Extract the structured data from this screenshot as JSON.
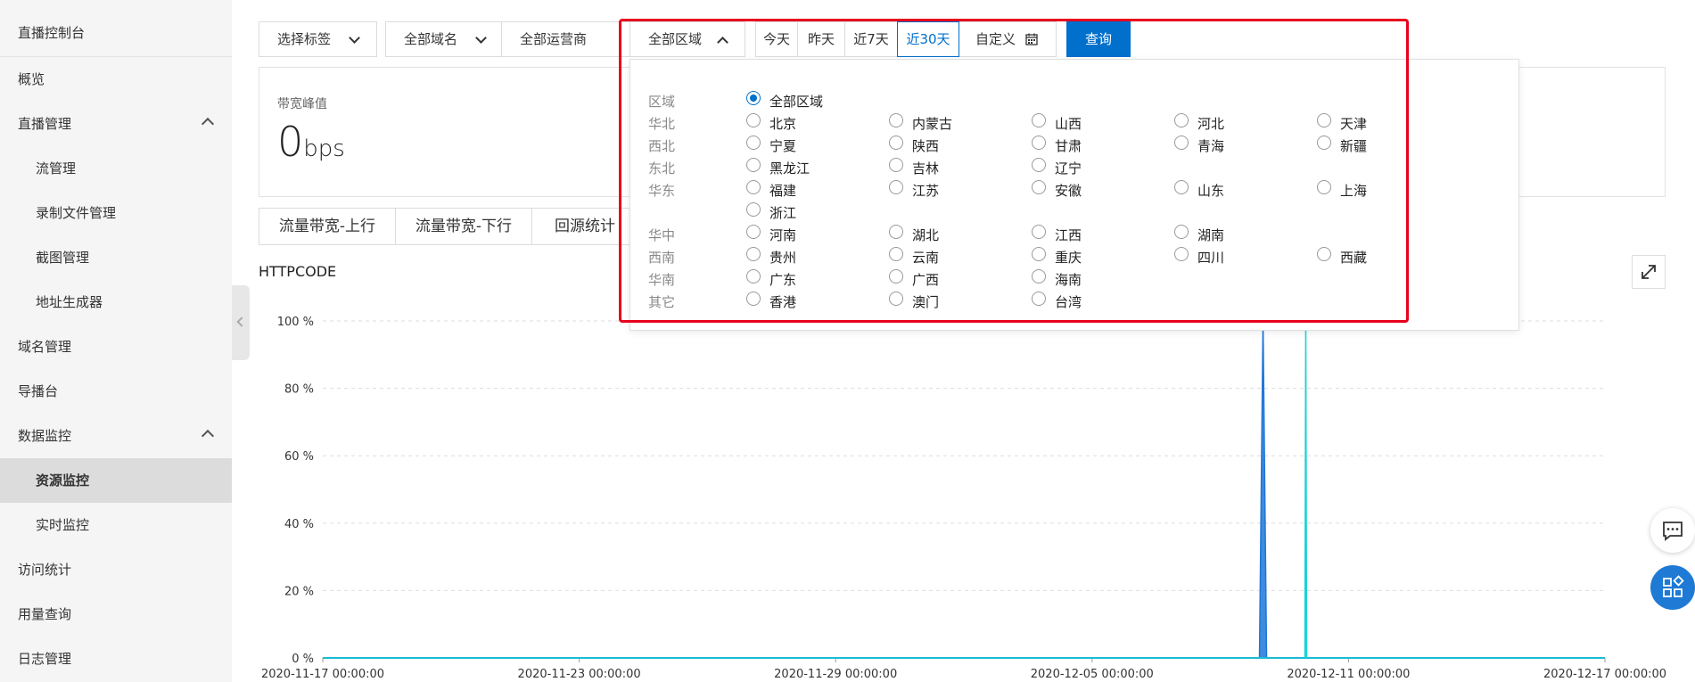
{
  "sidebar": {
    "title": "直播控制台",
    "items": [
      {
        "label": "概览",
        "sub": false
      },
      {
        "label": "直播管理",
        "sub": false,
        "expanded": true
      },
      {
        "label": "流管理",
        "sub": true
      },
      {
        "label": "录制文件管理",
        "sub": true
      },
      {
        "label": "截图管理",
        "sub": true
      },
      {
        "label": "地址生成器",
        "sub": true
      },
      {
        "label": "域名管理",
        "sub": false
      },
      {
        "label": "导播台",
        "sub": false
      },
      {
        "label": "数据监控",
        "sub": false,
        "expanded": true
      },
      {
        "label": "资源监控",
        "sub": true,
        "active": true
      },
      {
        "label": "实时监控",
        "sub": true
      },
      {
        "label": "访问统计",
        "sub": false
      },
      {
        "label": "用量查询",
        "sub": false
      },
      {
        "label": "日志管理",
        "sub": false
      }
    ]
  },
  "filters": {
    "tag": "选择标签",
    "domain": "全部域名",
    "isp": "全部运营商",
    "region": "全部区域"
  },
  "ranges": {
    "today": "今天",
    "yesterday": "昨天",
    "last7": "近7天",
    "last30": "近30天",
    "custom": "自定义",
    "active": "近30天"
  },
  "query_label": "查询",
  "peak": {
    "label": "带宽峰值",
    "value": "0",
    "unit": "bps"
  },
  "tabs": [
    "流量带宽-上行",
    "流量带宽-下行",
    "回源统计"
  ],
  "chart_title": "HTTPCODE",
  "region_panel": {
    "header_label": "区域",
    "all_option": "全部区域",
    "selected": "全部区域",
    "rows": [
      {
        "region": "华北",
        "options": [
          "北京",
          "内蒙古",
          "山西",
          "河北",
          "天津"
        ]
      },
      {
        "region": "西北",
        "options": [
          "宁夏",
          "陕西",
          "甘肃",
          "青海",
          "新疆"
        ]
      },
      {
        "region": "东北",
        "options": [
          "黑龙江",
          "吉林",
          "辽宁"
        ]
      },
      {
        "region": "华东",
        "options": [
          "福建",
          "江苏",
          "安徽",
          "山东",
          "上海"
        ]
      },
      {
        "region": "",
        "options": [
          "浙江"
        ]
      },
      {
        "region": "华中",
        "options": [
          "河南",
          "湖北",
          "江西",
          "湖南"
        ]
      },
      {
        "region": "西南",
        "options": [
          "贵州",
          "云南",
          "重庆",
          "四川",
          "西藏"
        ]
      },
      {
        "region": "华南",
        "options": [
          "广东",
          "广西",
          "海南"
        ]
      },
      {
        "region": "其它",
        "options": [
          "香港",
          "澳门",
          "台湾"
        ]
      }
    ]
  },
  "colors": {
    "accent": "#0070cc",
    "highlight": "#e8001c",
    "series1": "#1f77d8",
    "series2": "#19d3d3"
  },
  "chart_data": {
    "type": "area",
    "title": "",
    "xlabel": "",
    "ylabel": "",
    "x_ticks": [
      "2020-11-17 00:00:00",
      "2020-11-23 00:00:00",
      "2020-11-29 00:00:00",
      "2020-12-05 00:00:00",
      "2020-12-11 00:00:00",
      "2020-12-17 00:00:00"
    ],
    "y_ticks": [
      "0 %",
      "20 %",
      "40 %",
      "60 %",
      "80 %",
      "100 %"
    ],
    "ylim": [
      0,
      100
    ],
    "grid": true,
    "series": [
      {
        "x": [
          "2020-11-17",
          "2020-12-09",
          "2020-12-09",
          "2020-12-09",
          "2020-12-17"
        ],
        "values": [
          0,
          0,
          100,
          0,
          0
        ]
      },
      {
        "x": [
          "2020-11-17",
          "2020-12-10",
          "2020-12-10",
          "2020-12-10",
          "2020-12-17"
        ],
        "values": [
          0,
          0,
          100,
          0,
          0
        ]
      }
    ]
  },
  "float_icons": [
    "message-icon",
    "apps-icon"
  ]
}
